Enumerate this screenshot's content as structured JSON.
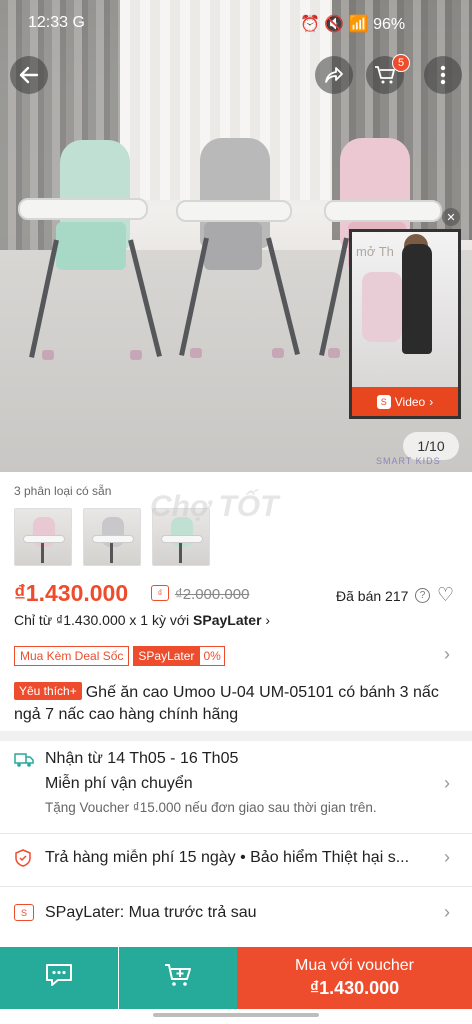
{
  "status_bar": {
    "time": "12:33 G",
    "battery": "96%"
  },
  "header": {
    "back_icon": "back-arrow-icon",
    "share_icon": "share-icon",
    "cart_icon": "cart-icon",
    "cart_count": "5",
    "more_icon": "more-icon"
  },
  "gallery": {
    "counter": "1/10",
    "brand_watermark": "SMART KIDS",
    "video_label": "Video",
    "video_overlay_text": "mở  Th"
  },
  "variants": {
    "label": "3 phân loại có sẵn",
    "count": 3,
    "watermark": "Chợ TỐT"
  },
  "pricing": {
    "price": "₫1.430.000",
    "original_price": "₫2.000.000",
    "sold": "Đã bán 217",
    "installment_prefix": "Chỉ từ ₫1.430.000 x 1 kỳ với",
    "installment_brand": "SPayLater"
  },
  "tags": {
    "deal": "Mua Kèm Deal Sốc",
    "spaylater": "SPayLater",
    "spaylater_rate": "0%"
  },
  "product": {
    "badge": "Yêu thích+",
    "title": "Ghế ăn cao Umoo U-04 UM-05101 có bánh 3 nấc ngả 7 nấc cao hàng chính hãng"
  },
  "shipping": {
    "line1": "Nhận từ 14 Th05 - 16 Th05",
    "line2": "Miễn phí vận chuyển",
    "line3": "Tặng Voucher ₫15.000 nếu đơn giao sau thời gian trên."
  },
  "returns": {
    "text": "Trả hàng miễn phí 15 ngày  •  Bảo hiểm Thiệt hại s..."
  },
  "spaylater_row": {
    "text": "SPayLater: Mua trước trả sau"
  },
  "bottom_bar": {
    "chat_icon": "chat-icon",
    "add_cart_icon": "add-to-cart-icon",
    "buy_line1": "Mua với voucher",
    "buy_line2": "₫1.430.000"
  },
  "colors": {
    "accent": "#ee4d2d",
    "teal": "#26aa99"
  }
}
